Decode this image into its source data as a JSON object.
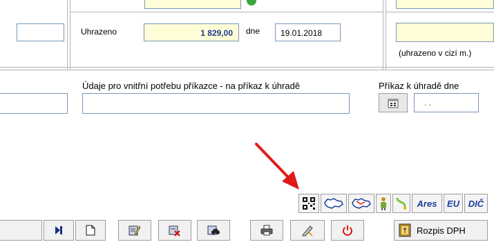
{
  "payment": {
    "paid_label": "Uhrazeno",
    "paid_amount": "1 829,00",
    "date_label": "dne",
    "paid_date": "19.01.2018",
    "foreign_note": "(uhrazeno v cizí m.)"
  },
  "internal": {
    "label": "Údaje pro vnitřní potřebu příkazce - na příkaz k úhradě",
    "value": ""
  },
  "order_date": {
    "label": "Příkaz k úhradě dne",
    "value": " . ."
  },
  "integrations": {
    "ares_label": "Ares",
    "eu_label": "EU",
    "dic_label": "DIČ"
  },
  "toolbar": {
    "rozpis_label": "Rozpis DPH"
  },
  "colors": {
    "field_border": "#7a96b8",
    "yellow_field": "#fffdd8",
    "amount_text": "#1e3c8c",
    "arrow": "#e01a1a",
    "power_icon": "#e01010"
  }
}
